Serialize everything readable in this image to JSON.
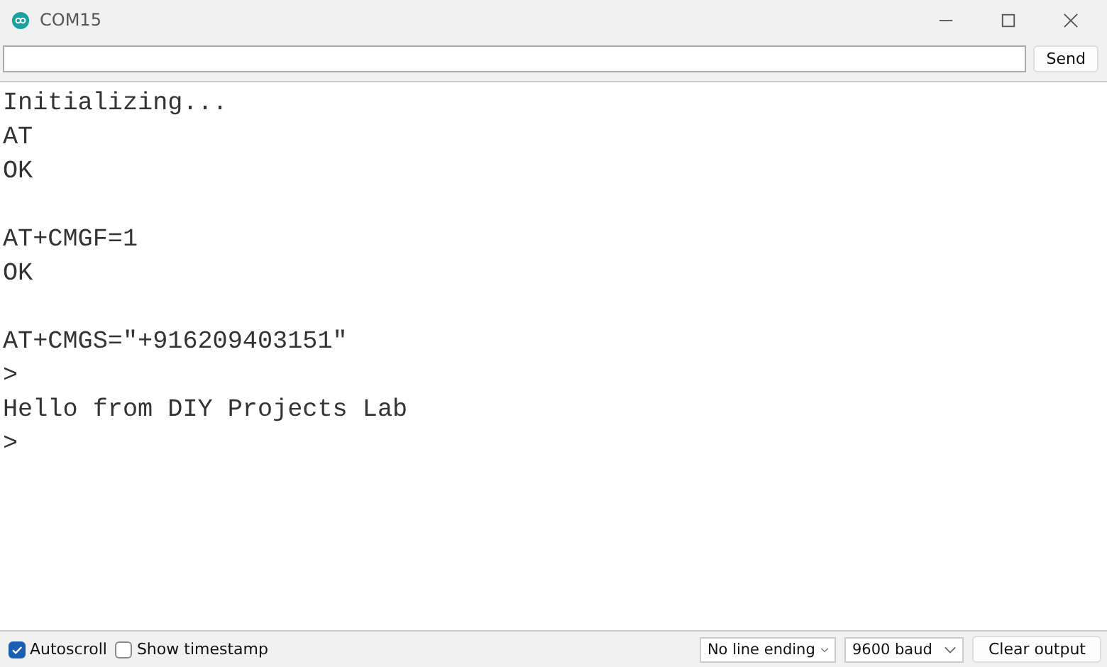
{
  "window": {
    "title": "COM15"
  },
  "send_button": "Send",
  "output_blocks": [
    [
      "Initializing...",
      "AT",
      "OK"
    ],
    [
      "AT+CMGF=1",
      "OK"
    ],
    [
      "AT+CMGS=\"+916209403151\"",
      ">",
      "Hello from DIY Projects Lab",
      ">"
    ]
  ],
  "autoscroll": {
    "label": "Autoscroll",
    "checked": true
  },
  "show_timestamp": {
    "label": "Show timestamp",
    "checked": false
  },
  "line_ending": "No line ending",
  "baud": "9600 baud",
  "clear_button": "Clear output"
}
